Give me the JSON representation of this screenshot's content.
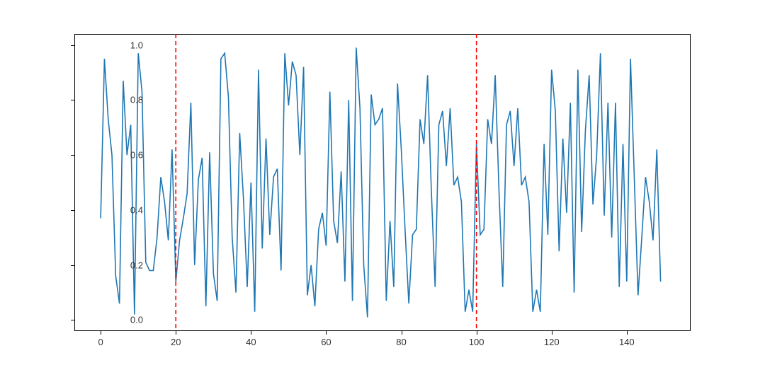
{
  "chart_data": {
    "type": "line",
    "x": [
      0,
      1,
      2,
      3,
      4,
      5,
      6,
      7,
      8,
      9,
      10,
      11,
      12,
      13,
      14,
      15,
      16,
      17,
      18,
      19,
      20,
      21,
      22,
      23,
      24,
      25,
      26,
      27,
      28,
      29,
      30,
      31,
      32,
      33,
      34,
      35,
      36,
      37,
      38,
      39,
      40,
      41,
      42,
      43,
      44,
      45,
      46,
      47,
      48,
      49,
      50,
      51,
      52,
      53,
      54,
      55,
      56,
      57,
      58,
      59,
      60,
      61,
      62,
      63,
      64,
      65,
      66,
      67,
      68,
      69,
      70,
      71,
      72,
      73,
      74,
      75,
      76,
      77,
      78,
      79,
      80,
      81,
      82,
      83,
      84,
      85,
      86,
      87,
      88,
      89,
      90,
      91,
      92,
      93,
      94,
      95,
      96,
      97,
      98,
      99,
      100,
      101,
      102,
      103,
      104,
      105,
      106,
      107,
      108,
      109,
      110,
      111,
      112,
      113,
      114,
      115,
      116,
      117,
      118,
      119,
      120,
      121,
      122,
      123,
      124,
      125,
      126,
      127,
      128,
      129,
      130,
      131,
      132,
      133,
      134,
      135,
      136,
      137,
      138,
      139,
      140,
      141,
      142,
      143,
      144,
      145,
      146,
      147,
      148,
      149
    ],
    "values": [
      0.37,
      0.95,
      0.73,
      0.6,
      0.16,
      0.06,
      0.87,
      0.6,
      0.71,
      0.02,
      0.97,
      0.83,
      0.21,
      0.18,
      0.18,
      0.3,
      0.52,
      0.43,
      0.29,
      0.62,
      0.14,
      0.29,
      0.37,
      0.46,
      0.79,
      0.2,
      0.51,
      0.59,
      0.05,
      0.61,
      0.17,
      0.07,
      0.95,
      0.97,
      0.81,
      0.3,
      0.1,
      0.68,
      0.44,
      0.12,
      0.5,
      0.03,
      0.91,
      0.26,
      0.66,
      0.31,
      0.52,
      0.55,
      0.18,
      0.97,
      0.78,
      0.94,
      0.89,
      0.6,
      0.92,
      0.09,
      0.2,
      0.05,
      0.33,
      0.39,
      0.27,
      0.83,
      0.36,
      0.28,
      0.54,
      0.14,
      0.8,
      0.07,
      0.99,
      0.77,
      0.2,
      0.01,
      0.82,
      0.71,
      0.73,
      0.77,
      0.07,
      0.36,
      0.12,
      0.86,
      0.62,
      0.33,
      0.06,
      0.31,
      0.33,
      0.73,
      0.64,
      0.89,
      0.47,
      0.12,
      0.71,
      0.76,
      0.56,
      0.77,
      0.49,
      0.52,
      0.43,
      0.03,
      0.11,
      0.03,
      0.64,
      0.31,
      0.33,
      0.73,
      0.64,
      0.89,
      0.47,
      0.12,
      0.71,
      0.76,
      0.56,
      0.77,
      0.49,
      0.52,
      0.43,
      0.03,
      0.11,
      0.03,
      0.64,
      0.31,
      0.91,
      0.76,
      0.25,
      0.66,
      0.39,
      0.79,
      0.1,
      0.91,
      0.32,
      0.69,
      0.89,
      0.42,
      0.6,
      0.97,
      0.38,
      0.79,
      0.3,
      0.79,
      0.12,
      0.64,
      0.14,
      0.95,
      0.52,
      0.09,
      0.3,
      0.52,
      0.43,
      0.29,
      0.62,
      0.14
    ],
    "vlines": [
      20,
      100
    ],
    "vline_color": "red",
    "vline_style": "dashed",
    "line_color": "#1f77b4",
    "xlabel": "",
    "ylabel": "",
    "title": "",
    "xlim": [
      -7,
      157
    ],
    "ylim": [
      -0.04,
      1.04
    ],
    "xticks": [
      0,
      20,
      40,
      60,
      80,
      100,
      120,
      140
    ],
    "yticks": [
      0.0,
      0.2,
      0.4,
      0.6,
      0.8,
      1.0
    ],
    "xtick_labels": [
      "0",
      "20",
      "40",
      "60",
      "80",
      "100",
      "120",
      "140"
    ],
    "ytick_labels": [
      "0.0",
      "0.2",
      "0.4",
      "0.6",
      "0.8",
      "1.0"
    ]
  }
}
